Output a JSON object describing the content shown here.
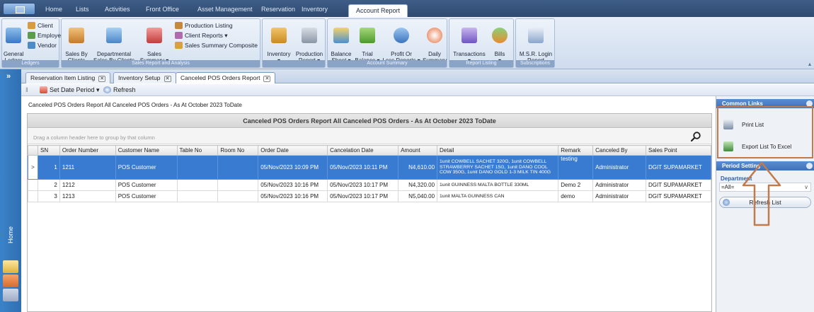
{
  "ribbon_tabs": [
    "Home",
    "Lists",
    "Activities",
    "Front Office",
    "Asset Management",
    "Reservation",
    "Inventory",
    "Account Report"
  ],
  "ribbon_active_tab": "Account Report",
  "ribbon": {
    "ledgers": {
      "title": "Ledgers",
      "general_ledger": "General\nLedger",
      "client": "Client",
      "employee": "Employee",
      "vendor": "Vendor"
    },
    "sales": {
      "title": "Sales Report and Analysis",
      "sales_by_clients": "Sales By\nClients",
      "departmental": "Departmental\nSales By Clients",
      "sales_summary": "Sales\nSummary ▾",
      "production_listing": "Production Listing",
      "client_reports": "Client Reports ▾",
      "sales_summary_composite": "Sales Summary Composite"
    },
    "inventory": {
      "inventory": "Inventory\n▾",
      "production_report": "Production\nReport ▾"
    },
    "account_summary": {
      "title": "Account Summary",
      "balance_sheet": "Balance\nSheet ▾",
      "trial_balance": "Trial\nBalance ▾",
      "profit_or_loss": "Profit Or\nLoss Reports ▾",
      "daily_summary": "Daily\nSummary"
    },
    "report_listing": {
      "title": "Report Listing",
      "transactions": "Transactions\n▾",
      "bills": "Bills\n▾"
    },
    "subscriptions": {
      "title": "Subscriptions",
      "msr_login_report": "M.S.R. Login\nReport"
    }
  },
  "left_bar": {
    "label": "Home"
  },
  "doc_tabs": [
    "Reservation Item Listing",
    "Inventory Setup",
    "Canceled POS Orders Report"
  ],
  "doc_tab_close": "✕",
  "toolbar": {
    "set_date_period": "Set Date Period ▾",
    "refresh": "Refresh"
  },
  "content_title": "Canceled POS Orders Report All Canceled POS Orders - As At October 2023 ToDate",
  "grid": {
    "caption": "Canceled POS Orders Report All Canceled POS Orders - As At October 2023 ToDate",
    "group_hint": "Drag a column header here to group by that column",
    "columns": [
      "SN",
      "Order Number",
      "Customer Name",
      "Table No",
      "Room No",
      "Order Date",
      "Cancelation Date",
      "Amount",
      "Detail",
      "Remark",
      "Canceled By",
      "Sales Point"
    ],
    "rows": [
      {
        "indicator": ">",
        "sn": "1",
        "order_number": "1211",
        "customer_name": "POS Customer",
        "table_no": "",
        "room_no": "",
        "order_date": "05/Nov/2023 10:09 PM",
        "cancel_date": "05/Nov/2023 10:11 PM",
        "amount": "N4,610.00",
        "detail": "1unit COWBELL SACHET 320G, 1unit COWBELL STRAWBERRY SACHET 15G, 1unit DANO COOL COW 350G, 1unit DANO GOLD 1-3 MILK TIN 400G",
        "remark": "testing",
        "canceled_by": "Administrator",
        "sales_point": "DGIT SUPAMARKET"
      },
      {
        "indicator": "",
        "sn": "2",
        "order_number": "1212",
        "customer_name": "POS Customer",
        "table_no": "",
        "room_no": "",
        "order_date": "05/Nov/2023 10:16 PM",
        "cancel_date": "05/Nov/2023 10:17 PM",
        "amount": "N4,320.00",
        "detail": "1unit GUINNESS MALTA BOTTLE 330ML",
        "remark": "Demo 2",
        "canceled_by": "Administrator",
        "sales_point": "DGIT SUPAMARKET"
      },
      {
        "indicator": "",
        "sn": "3",
        "order_number": "1213",
        "customer_name": "POS Customer",
        "table_no": "",
        "room_no": "",
        "order_date": "05/Nov/2023 10:16 PM",
        "cancel_date": "05/Nov/2023 10:17 PM",
        "amount": "N5,040.00",
        "detail": "1unit MALTA GUINNESS CAN",
        "remark": "demo",
        "canceled_by": "Administrator",
        "sales_point": "DGIT SUPAMARKET"
      }
    ]
  },
  "right_panel": {
    "common_links_title": "Common Links",
    "print_list": "Print List",
    "export_excel": "Export List To Excel",
    "period_setting_title": "Period Setting",
    "department_label": "Department",
    "department_value": "=All=",
    "refresh_list": "Refresh List"
  },
  "colors": {
    "selected_row": "#3a7bd2",
    "accent_blue": "#3d70b8",
    "annotation": "#c07a4c"
  }
}
